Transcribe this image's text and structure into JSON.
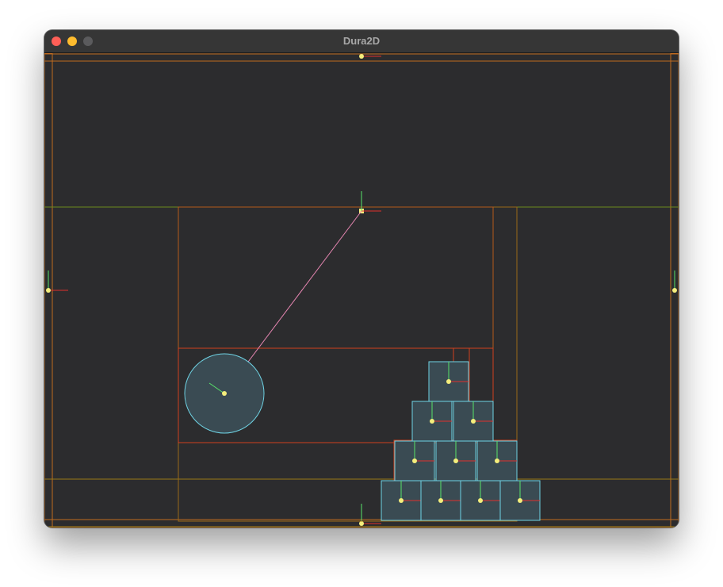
{
  "window": {
    "title": "Dura2D"
  },
  "colors": {
    "background": "#2c2c2e",
    "body_fill": "#3a4b53",
    "body_outline": "#6fd3e4",
    "aabb_outline": "#d1411e",
    "static_outline": "#c06b1f",
    "joint_line": "#e887b3",
    "center_dot": "#f4ee7c",
    "axis_x": "#e0302c",
    "axis_y": "#58e36a"
  }
}
